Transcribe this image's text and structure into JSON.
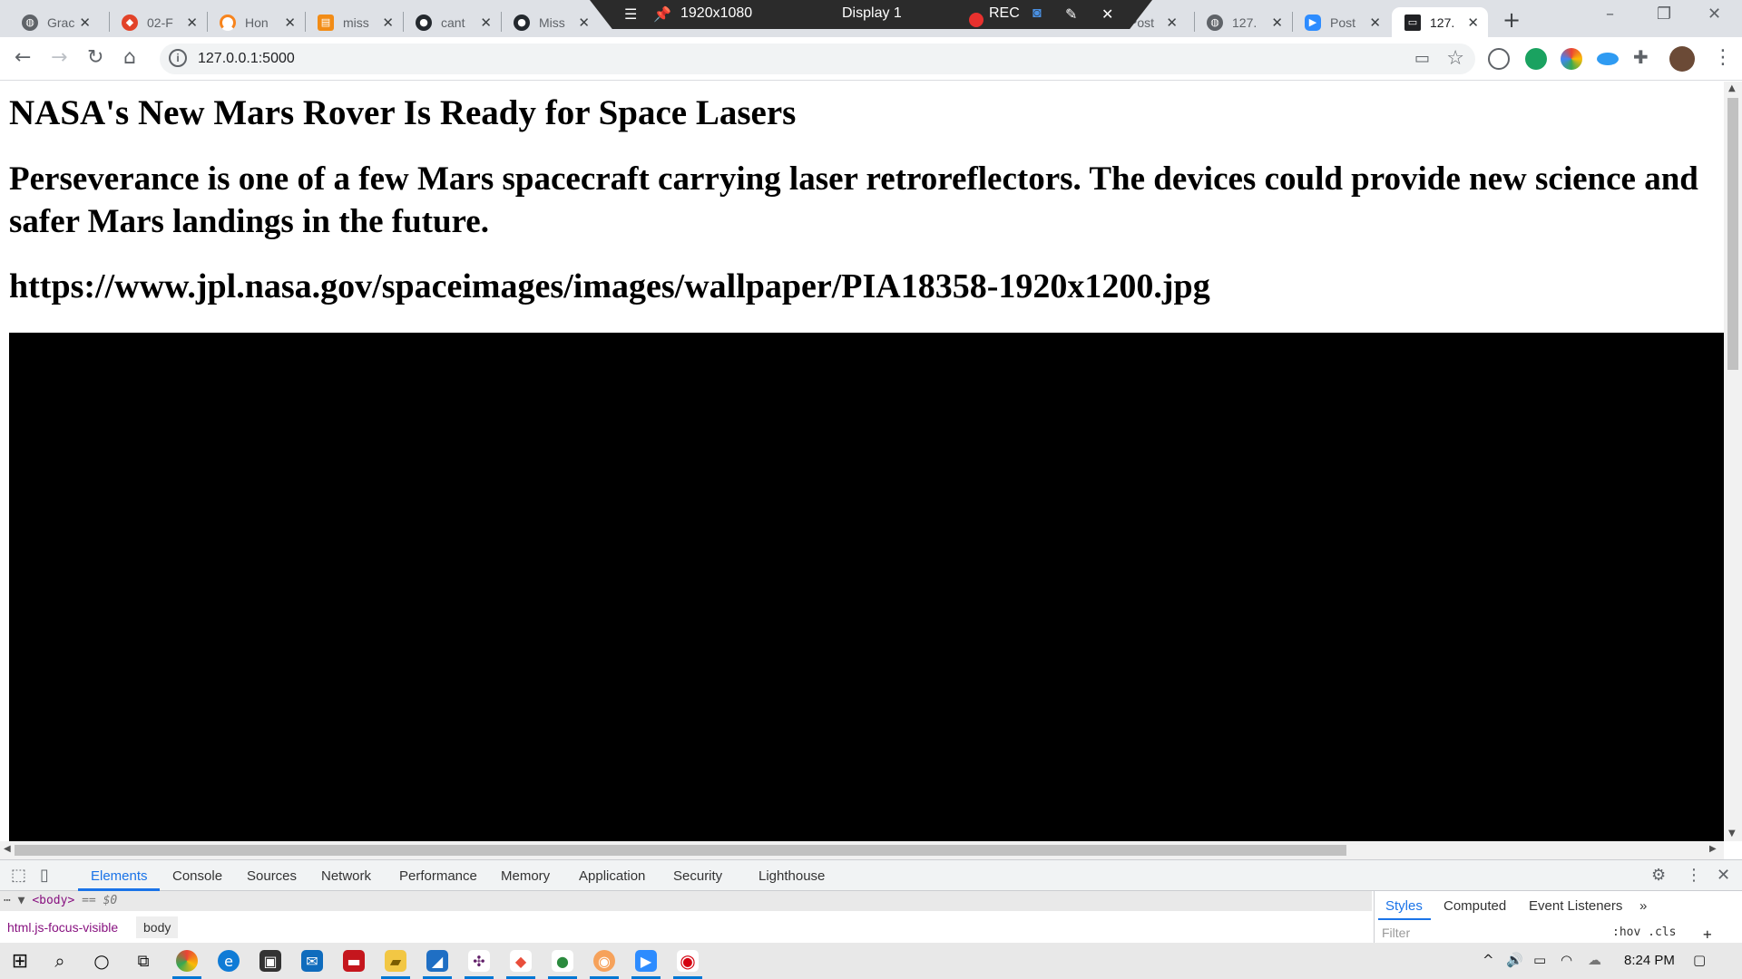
{
  "browser": {
    "tabs": [
      {
        "title": "Grac",
        "icon": "globe-icon",
        "color": "#5f6368"
      },
      {
        "title": "02-F",
        "icon": "gitlab-icon",
        "color": "#e24329"
      },
      {
        "title": "Hon",
        "icon": "arc-icon",
        "color": "#f7841d"
      },
      {
        "title": "miss",
        "icon": "bookmark-doc-icon",
        "color": "#f28c16"
      },
      {
        "title": "cant",
        "icon": "github-icon",
        "color": "#24292e"
      },
      {
        "title": "Miss",
        "icon": "github-icon",
        "color": "#24292e"
      },
      {
        "title": "Post",
        "icon": "blank-icon",
        "color": "#bbbbbb"
      },
      {
        "title": "127.",
        "icon": "globe-icon",
        "color": "#5f6368"
      },
      {
        "title": "Post",
        "icon": "zoom-icon",
        "color": "#2d8cff"
      },
      {
        "title": "127.",
        "icon": "terminal-icon",
        "color": "#202124",
        "active": true
      }
    ],
    "new_tab_glyph": "+",
    "url": "127.0.0.1:5000"
  },
  "recording_bar": {
    "resolution": "1920x1080",
    "display": "Display 1",
    "rec_label": "REC"
  },
  "page": {
    "title": "NASA's New Mars Rover Is Ready for Space Lasers",
    "description": "Perseverance is one of a few Mars spacecraft carrying laser retroreflectors. The devices could provide new science and safer Mars landings in the future.",
    "image_url": "https://www.jpl.nasa.gov/spaceimages/images/wallpaper/PIA18358-1920x1200.jpg"
  },
  "devtools": {
    "tabs": [
      "Elements",
      "Console",
      "Sources",
      "Network",
      "Performance",
      "Memory",
      "Application",
      "Security",
      "Lighthouse"
    ],
    "active_tab": "Elements",
    "selected_node": "<body>",
    "selected_node_suffix": "== $0",
    "breadcrumbs": [
      "html.js-focus-visible",
      "body"
    ],
    "side_tabs": [
      "Styles",
      "Computed",
      "Event Listeners"
    ],
    "filter_placeholder": "Filter",
    "hov_cls": ":hov  .cls"
  },
  "taskbar": {
    "time": "8:24 PM"
  }
}
